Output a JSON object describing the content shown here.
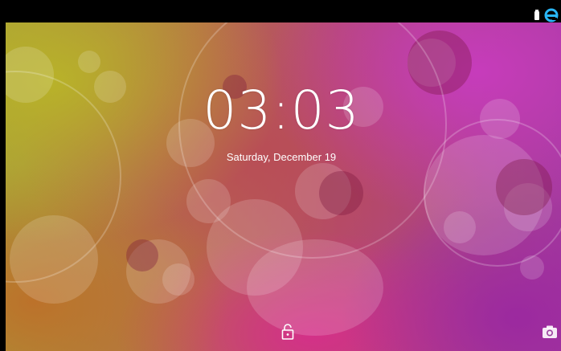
{
  "status_bar": {
    "battery_icon": "battery-icon",
    "notification_icon": "notification-account-icon",
    "accent_color": "#29b6f6"
  },
  "lock_screen": {
    "time": "03:03",
    "date": "Saturday, December 19",
    "unlock_icon": "unlock-padlock-icon",
    "camera_icon": "camera-icon"
  }
}
